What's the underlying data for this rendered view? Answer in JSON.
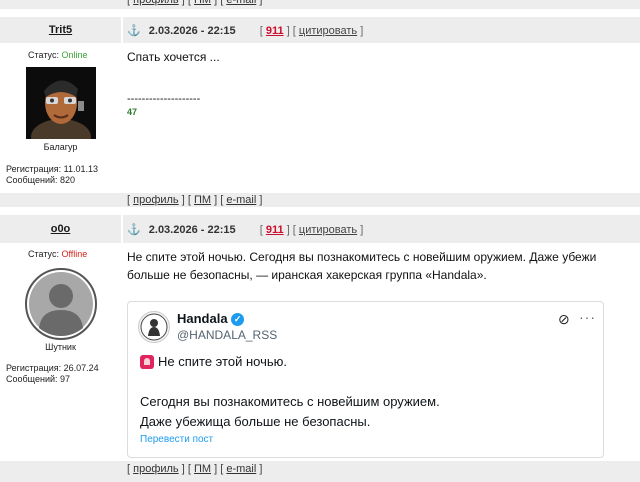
{
  "links": {
    "profile": "профиль",
    "pm": "ПМ",
    "email": "e-mail",
    "open": "[",
    "sep": "] [",
    "close": "]"
  },
  "posts": [
    {
      "username": "Trit5",
      "status_label": "Статус:",
      "status": "Online",
      "status_color": "#3aa53a",
      "rank": "Балагур",
      "reg_label": "Регистрация:",
      "reg_date": "11.01.13",
      "posts_label": "Сообщений:",
      "posts_count": "820",
      "date": "2.03.2026 - 22:15",
      "post_number": "911",
      "quote_label": "цитировать",
      "message": "Спать хочется ...",
      "signature_line": "--------------------",
      "signature": "47"
    },
    {
      "username": "o0o",
      "status_label": "Статус:",
      "status": "Offline",
      "status_color": "#d4261c",
      "rank": "Шутник",
      "reg_label": "Регистрация:",
      "reg_date": "26.07.24",
      "posts_label": "Сообщений:",
      "posts_count": "97",
      "date": "2.03.2026 - 22:15",
      "post_number": "911",
      "quote_label": "цитировать",
      "message_line1": "Не спите этой ночью. Сегодня вы познакомитесь с новейшим оружием. Даже убежи",
      "message_line2": "больше не безопасны, — иранская хакерская группа «Handala».",
      "embed": {
        "name": "Handala",
        "handle": "@HANDALA_RSS",
        "verified_icon": "verified-badge-icon",
        "line1": "Не спите этой ночью.",
        "line2": "Сегодня вы познакомитесь с новейшим оружием.",
        "line3": "Даже убежища больше не безопасны.",
        "translate": "Перевести пост"
      }
    }
  ]
}
